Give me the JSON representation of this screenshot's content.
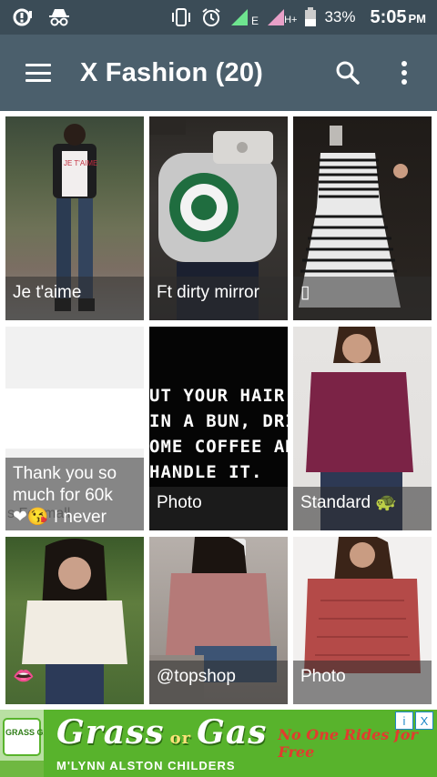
{
  "status_bar": {
    "signal_network": "E",
    "signal_network2": "H+",
    "battery": "33%",
    "time": "5:05",
    "ampm": "PM"
  },
  "toolbar": {
    "title": "X Fashion (20)"
  },
  "tiles": [
    {
      "caption": "Je t'aime"
    },
    {
      "caption": "Ft dirty mirror"
    },
    {
      "caption": "▯"
    },
    {
      "caption": "Thank you so\nmuch for 60k\n❤😘 I never"
    },
    {
      "caption": "Photo",
      "image_text": "UT YOUR HAIR U\nIN A BUN, DRINK\nOME COFFEE AN\nHANDLE IT."
    },
    {
      "caption": "Standard 🐢"
    },
    {
      "caption": "👄"
    },
    {
      "caption": "@topshop"
    },
    {
      "caption": "Photo"
    }
  ],
  "ad": {
    "title_left": "Grass",
    "title_or": "or",
    "title_right": "Gas",
    "subtitle": "M'LYNN ALSTON CHILDERS",
    "tagline": "No One Rides for Free",
    "logo_text": "GRASS GAS",
    "info_label": "i",
    "close_label": "X"
  },
  "colors": {
    "statusbar_bg": "#3b4c57",
    "toolbar_bg": "#4b5f6c",
    "ad_bg": "#58b32c"
  }
}
